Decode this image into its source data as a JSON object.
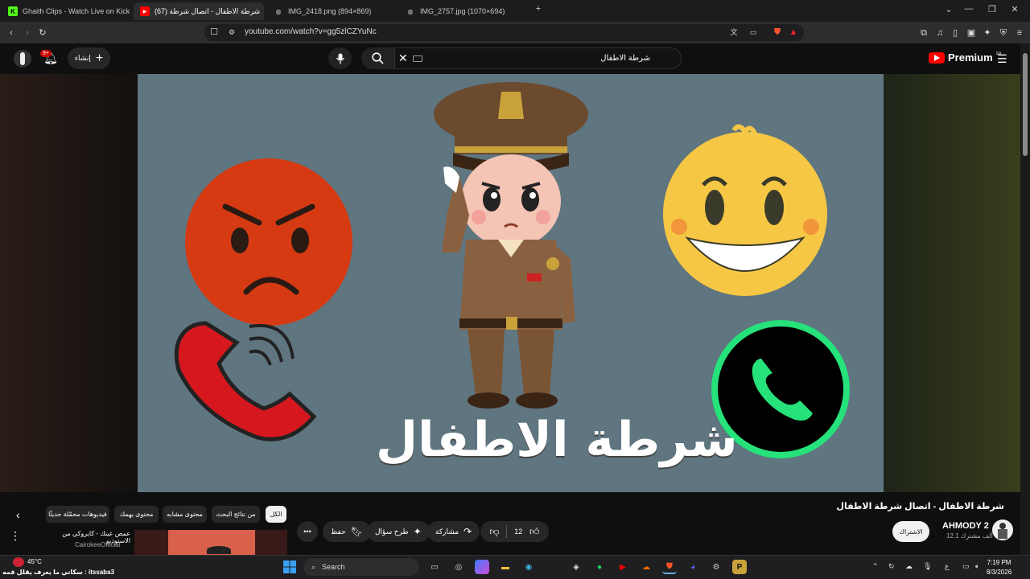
{
  "browser": {
    "tabs": [
      {
        "title": "Ghaith Clips - Watch Live on Kick",
        "favicon": "kick-icon"
      },
      {
        "title": "(67) شرطة الاطفال - اتصال شرطة",
        "favicon": "youtube-icon"
      },
      {
        "title": "IMG_2418.png (894×869)",
        "favicon": "globe-icon"
      },
      {
        "title": "IMG_2757.jpg (1070×694)",
        "favicon": "globe-icon"
      }
    ],
    "new_tab": "+",
    "url": "youtube.com/watch?v=gg5zlCZYuNc"
  },
  "youtube": {
    "logo": "Premium",
    "logo_region": "SA",
    "search_value": "شرطة الاطفال",
    "create_label": "إنشاء",
    "notifications_badge": "9+",
    "video_overlay_title": "شرطة الاطفال",
    "video_title": "شرطة الاطفال - اتصال شرطة الاطفال",
    "channel_name": "AHMODY 2",
    "subscribers": "12.1 ألف مشترك",
    "subscribe_label": "الاشتراك",
    "likes": "12",
    "share_label": "مشاركة",
    "ask_label": "طرح سؤال",
    "save_label": "حفظ",
    "chips": [
      "الكل",
      "من نتائج البحث",
      "محتوى مشابه",
      "محتوى يهمك",
      "فيديوهات محمّلة حديثًا"
    ],
    "related": {
      "title": "عمص عينك - كايروكي من الاستوديو",
      "channel": "CairokeeOfficial"
    }
  },
  "taskbar": {
    "weather": "45°C",
    "ticker": "سكاتي ما يعرف يقلل قمه : itssaba3",
    "search_placeholder": "Search",
    "time": "7:19 PM",
    "date": "8/3/2026",
    "lang": "ع"
  },
  "colors": {
    "yt_red": "#ff0000",
    "video_bg": "#5f7580",
    "angry_face": "#d63a12",
    "happy_face": "#f6c744",
    "phone_red": "#d6181e",
    "whatsapp_green": "#25e27a"
  }
}
